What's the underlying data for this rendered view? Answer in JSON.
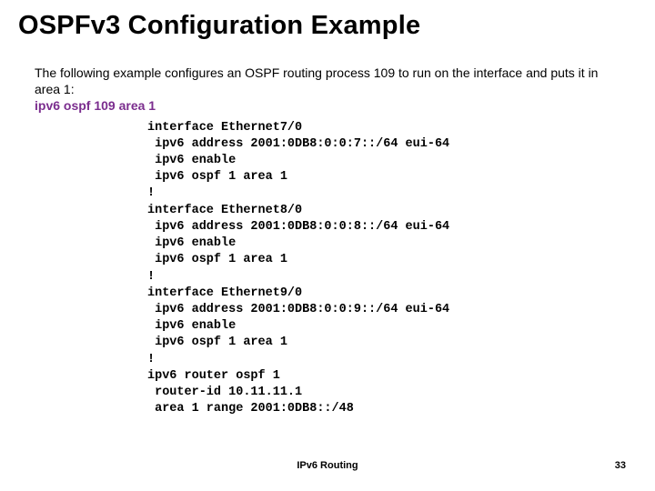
{
  "slide": {
    "title": "OSPFv3 Configuration Example",
    "description": "The following example configures an OSPF routing process 109 to run on the interface and puts it in area 1:",
    "command": "ipv6 ospf 109 area 1",
    "code": "interface Ethernet7/0\n ipv6 address 2001:0DB8:0:0:7::/64 eui-64\n ipv6 enable\n ipv6 ospf 1 area 1\n!\ninterface Ethernet8/0\n ipv6 address 2001:0DB8:0:0:8::/64 eui-64\n ipv6 enable\n ipv6 ospf 1 area 1\n!\ninterface Ethernet9/0\n ipv6 address 2001:0DB8:0:0:9::/64 eui-64\n ipv6 enable\n ipv6 ospf 1 area 1\n!\nipv6 router ospf 1\n router-id 10.11.11.1\n area 1 range 2001:0DB8::/48"
  },
  "footer": {
    "label": "IPv6 Routing",
    "page": "33"
  }
}
